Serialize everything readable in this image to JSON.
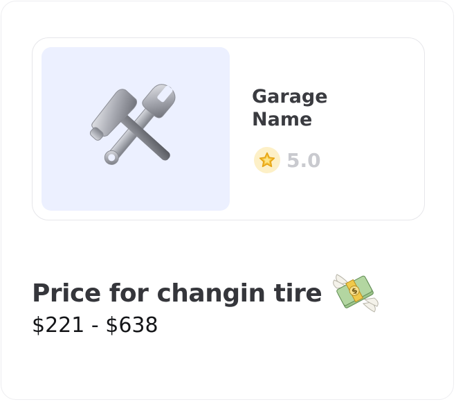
{
  "garage": {
    "name": "Garage Name",
    "rating": "5.0",
    "image_icon": "hammer-and-wrench-icon",
    "rating_icon": "star-icon"
  },
  "price": {
    "title": "Price for changin tire",
    "range": "$221 - $638",
    "icon": "money-with-wings-icon"
  },
  "colors": {
    "image_background": "#ecf0ff",
    "star_badge": "#fdf0c7",
    "star": "#f2b51b",
    "title_text": "#35363b",
    "rating_text": "#c9cacf"
  }
}
